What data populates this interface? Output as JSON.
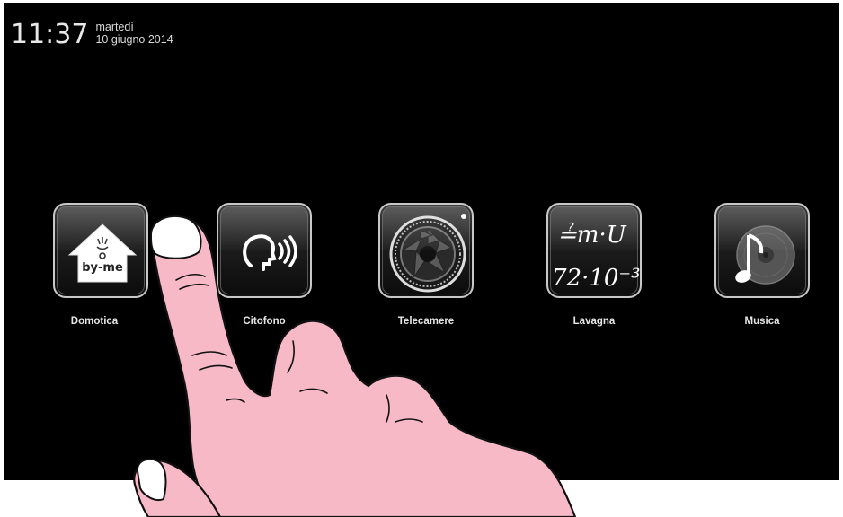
{
  "status": {
    "time": "11:37",
    "weekday": "martedì",
    "date": "10 giugno 2014"
  },
  "apps": [
    {
      "label": "Domotica",
      "icon": "by-me-house-icon"
    },
    {
      "label": "Citofono",
      "icon": "intercom-head-icon"
    },
    {
      "label": "Telecamere",
      "icon": "camera-lens-icon"
    },
    {
      "label": "Lavagna",
      "icon": "chalkboard-icon"
    },
    {
      "label": "Musica",
      "icon": "music-disc-icon"
    }
  ],
  "icon_texts": {
    "domotica_logo": "by-me",
    "lavagna_scribble_top": "≟m·U",
    "lavagna_scribble_bottom": "72·10⁻³(-"
  },
  "colors": {
    "screen_background": "#000000",
    "label_text": "#e6e6e6",
    "hand_skin": "#f7b9c6"
  }
}
